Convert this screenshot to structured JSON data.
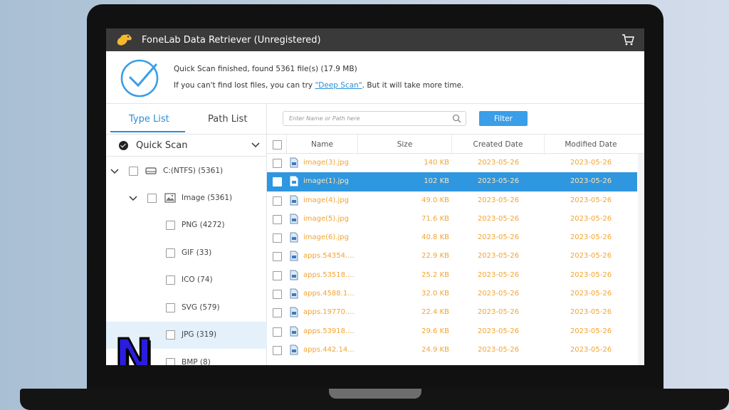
{
  "window": {
    "title": "FoneLab Data Retriever (Unregistered)"
  },
  "status": {
    "line1": "Quick Scan finished, found 5361 file(s) (17.9 MB)",
    "line2_prefix": "If you can't find lost files, you can try ",
    "deep_scan_link": "\"Deep Scan\"",
    "line2_suffix": ". But it will take more time."
  },
  "tabs": {
    "type_list": "Type List",
    "path_list": "Path List"
  },
  "scan_mode": {
    "label": "Quick Scan"
  },
  "tree": [
    {
      "label": "C:(NTFS) (5361)",
      "level": 0,
      "expandable": true,
      "icon": "drive-icon"
    },
    {
      "label": "Image (5361)",
      "level": 1,
      "expandable": true,
      "icon": "image-icon"
    },
    {
      "label": "PNG (4272)",
      "level": 2
    },
    {
      "label": "GIF (33)",
      "level": 2
    },
    {
      "label": "ICO (74)",
      "level": 2
    },
    {
      "label": "SVG (579)",
      "level": 2
    },
    {
      "label": "JPG (319)",
      "level": 2,
      "selected": true
    },
    {
      "label": "BMP (8)",
      "level": 2
    }
  ],
  "search": {
    "placeholder": "Enter Name or Path here"
  },
  "filter_label": "Filter",
  "columns": {
    "name": "Name",
    "size": "Size",
    "created": "Created Date",
    "modified": "Modified Date"
  },
  "files": [
    {
      "name": "image(3).jpg",
      "size": "140 KB",
      "created": "2023-05-26",
      "modified": "2023-05-26"
    },
    {
      "name": "image(1).jpg",
      "size": "102 KB",
      "created": "2023-05-26",
      "modified": "2023-05-26",
      "selected": true
    },
    {
      "name": "image(4).jpg",
      "size": "49.0 KB",
      "created": "2023-05-26",
      "modified": "2023-05-26"
    },
    {
      "name": "image(5).jpg",
      "size": "71.6 KB",
      "created": "2023-05-26",
      "modified": "2023-05-26"
    },
    {
      "name": "image(6).jpg",
      "size": "40.8 KB",
      "created": "2023-05-26",
      "modified": "2023-05-26"
    },
    {
      "name": "apps.54354....",
      "size": "22.9 KB",
      "created": "2023-05-26",
      "modified": "2023-05-26"
    },
    {
      "name": "apps.53518....",
      "size": "25.2 KB",
      "created": "2023-05-26",
      "modified": "2023-05-26"
    },
    {
      "name": "apps.4588.1...",
      "size": "32.0 KB",
      "created": "2023-05-26",
      "modified": "2023-05-26"
    },
    {
      "name": "apps.19770....",
      "size": "22.4 KB",
      "created": "2023-05-26",
      "modified": "2023-05-26"
    },
    {
      "name": "apps.53918....",
      "size": "29.6 KB",
      "created": "2023-05-26",
      "modified": "2023-05-26"
    },
    {
      "name": "apps.442.14...",
      "size": "24.9 KB",
      "created": "2023-05-26",
      "modified": "2023-05-26"
    }
  ],
  "colors": {
    "accent": "#2a8fd6",
    "file_text": "#f2a433",
    "title_bar": "#3a3a3a",
    "selected_row": "#2f96e0"
  },
  "overlay_logo": {
    "letter": "N"
  }
}
